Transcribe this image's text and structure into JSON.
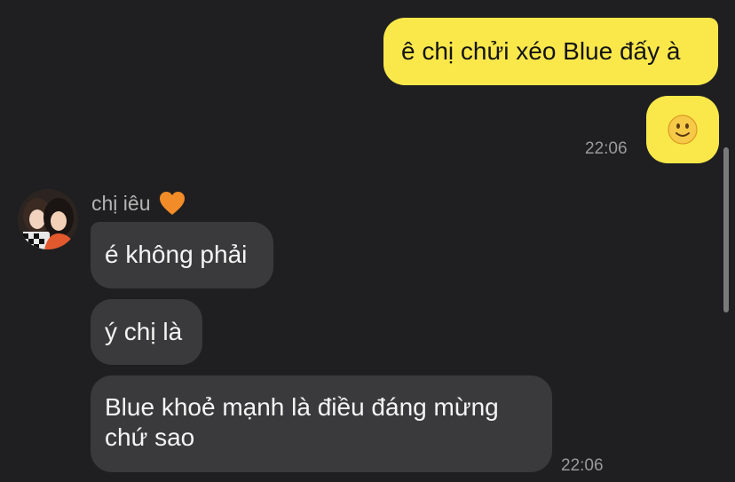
{
  "messages_out": {
    "m1": "ê chị chửi xéo Blue đấy à",
    "m2_emoji": "slightly-smiling-face",
    "time": "22:06"
  },
  "sender": {
    "name": "chị iêu",
    "name_emoji": "orange-heart"
  },
  "messages_in": {
    "m1": "é không phải",
    "m2": "ý chị là",
    "m3_line1": "Blue khoẻ mạnh là điều đáng mừng",
    "m3_line2": "chứ sao",
    "time": "22:06"
  },
  "colors": {
    "background": "#1f1f21",
    "outgoing_bubble": "#fae84b",
    "incoming_bubble": "#3a3a3c",
    "timestamp": "#9a9a9a",
    "heart": "#f28c28"
  }
}
